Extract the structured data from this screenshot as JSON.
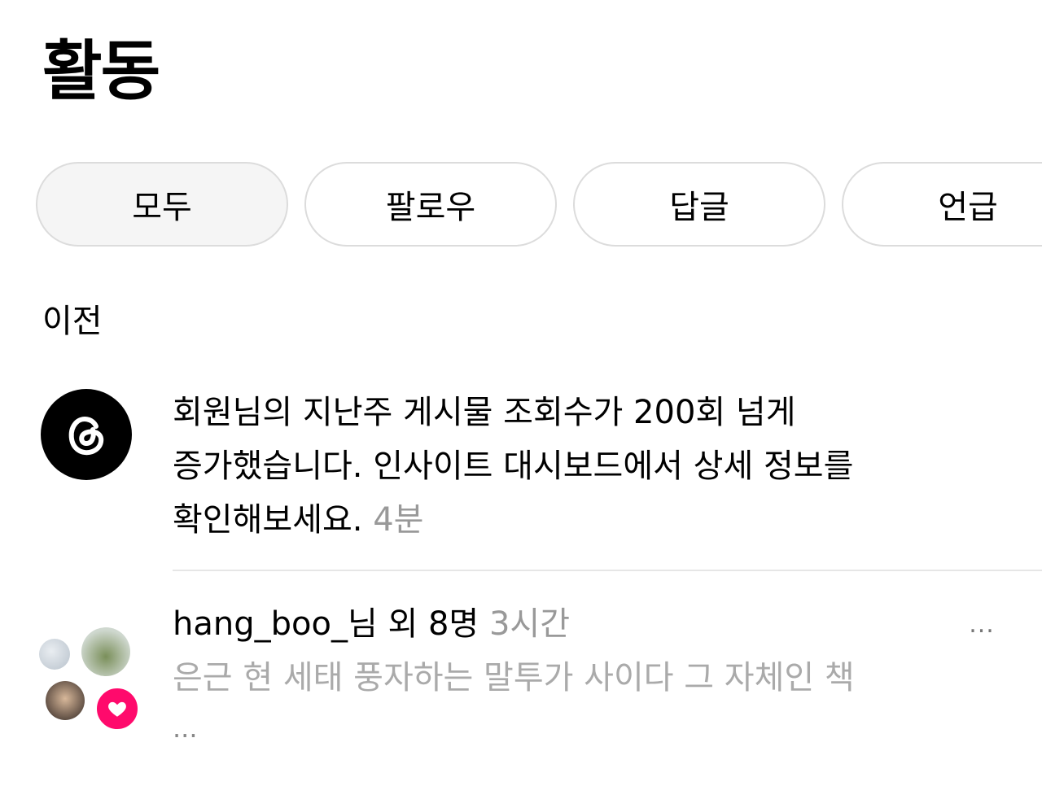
{
  "header": {
    "title": "활동"
  },
  "tabs": [
    {
      "label": "모두",
      "active": true
    },
    {
      "label": "팔로우",
      "active": false
    },
    {
      "label": "답글",
      "active": false
    },
    {
      "label": "언급",
      "active": false
    }
  ],
  "section": {
    "label": "이전"
  },
  "notifications": [
    {
      "icon": "threads-logo-icon",
      "line1": "회원님의 지난주 게시물 조회수가 200회 넘게",
      "line2": "증가했습니다. 인사이트 대시보드에서 상세 정보를",
      "line3": "확인해보세요.",
      "time": "4분"
    },
    {
      "icon": "heart-icon",
      "title": "hang_boo_님 외 8명",
      "time": "3시간",
      "preview": "은근 현 세태 풍자하는 말투가 사이다 그 자체인 책",
      "ellipsis": "...",
      "more": "..."
    }
  ],
  "colors": {
    "heart": "#ff0a6c",
    "muted": "#999999",
    "border": "#dcdcdc"
  }
}
